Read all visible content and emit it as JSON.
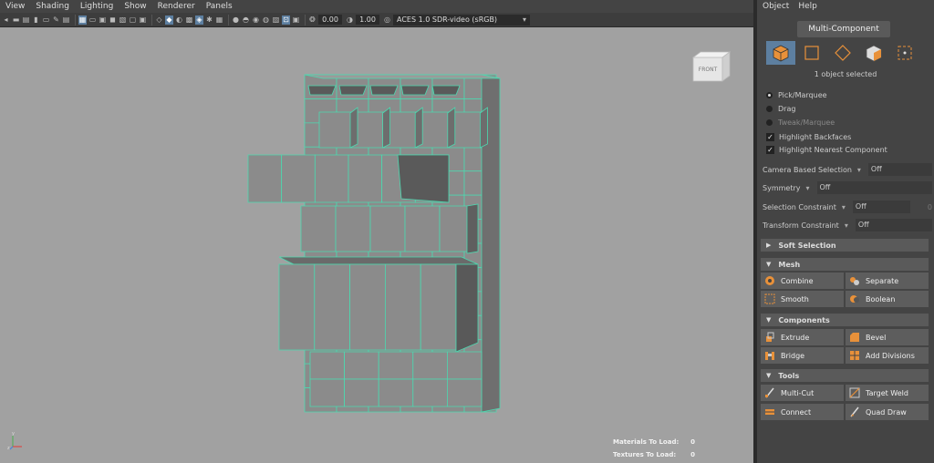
{
  "menubar": {
    "items": [
      "View",
      "Shading",
      "Lighting",
      "Show",
      "Renderer",
      "Panels"
    ]
  },
  "toolbar": {
    "field_a": "0.00",
    "field_b": "1.00",
    "color_space": "ACES 1.0 SDR-video (sRGB)"
  },
  "viewport": {
    "viewcube_label": "FRONT",
    "hud": {
      "materials_label": "Materials To Load:",
      "materials_value": "0",
      "textures_label": "Textures To Load:",
      "textures_value": "0"
    },
    "axis": {
      "y": "y",
      "z": "z"
    }
  },
  "panel": {
    "menu": [
      "Object",
      "Help"
    ],
    "title": "Multi-Component",
    "selection_count": "1 object selected",
    "modes": [
      {
        "icon": "object-mode-icon",
        "active": true
      },
      {
        "icon": "face-mode-icon",
        "active": false
      },
      {
        "icon": "vertex-mode-icon",
        "active": false
      },
      {
        "icon": "uv-mode-icon",
        "active": false
      },
      {
        "icon": "component-mode-icon",
        "active": false
      }
    ],
    "options": {
      "pick_marquee": "Pick/Marquee",
      "drag": "Drag",
      "tweak_marquee": "Tweak/Marquee",
      "highlight_backfaces": "Highlight Backfaces",
      "highlight_nearest": "Highlight Nearest Component"
    },
    "dropdowns": {
      "camera_based": {
        "label": "Camera Based Selection",
        "value": "Off"
      },
      "symmetry": {
        "label": "Symmetry",
        "value": "Off"
      },
      "selection_constraint": {
        "label": "Selection Constraint",
        "value": "Off",
        "number": "0"
      },
      "transform_constraint": {
        "label": "Transform Constraint",
        "value": "Off"
      }
    },
    "sections": {
      "soft_selection": "Soft Selection",
      "mesh": "Mesh",
      "components": "Components",
      "tools": "Tools"
    },
    "buttons": {
      "combine": "Combine",
      "separate": "Separate",
      "smooth": "Smooth",
      "boolean": "Boolean",
      "extrude": "Extrude",
      "bevel": "Bevel",
      "bridge": "Bridge",
      "add_divisions": "Add Divisions",
      "multi_cut": "Multi-Cut",
      "target_weld": "Target Weld",
      "connect": "Connect",
      "quad_draw": "Quad Draw"
    }
  },
  "colors": {
    "viewport_bg": "#a1a1a1",
    "mesh_face": "#8b8b8b",
    "mesh_wire": "#4cd9b0",
    "accent": "#5d7fa0",
    "icon_orange": "#e8913a"
  }
}
